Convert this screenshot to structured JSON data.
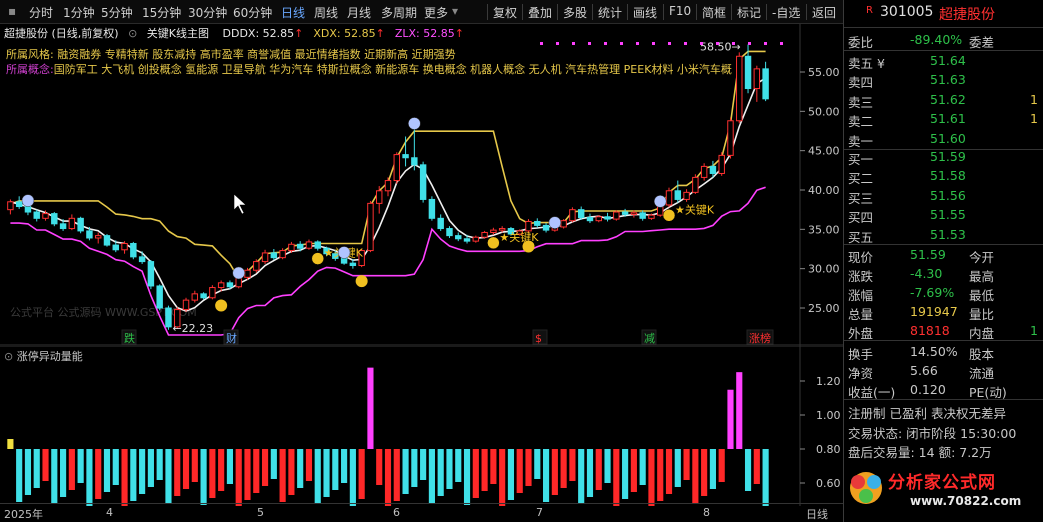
{
  "toolbar": {
    "left_items": [
      {
        "label": "分时",
        "active": false
      },
      {
        "label": "1分钟",
        "active": false
      },
      {
        "label": "5分钟",
        "active": false
      },
      {
        "label": "15分钟",
        "active": false
      },
      {
        "label": "30分钟",
        "active": false
      },
      {
        "label": "60分钟",
        "active": false
      },
      {
        "label": "日线",
        "active": true
      },
      {
        "label": "周线",
        "active": false
      },
      {
        "label": "月线",
        "active": false
      },
      {
        "label": "多周期",
        "active": false
      },
      {
        "label": "更多",
        "active": false
      }
    ],
    "right_items": [
      "复权",
      "叠加",
      "多股",
      "统计",
      "画线",
      "F10",
      "简框",
      "标记",
      "-自选",
      "返回"
    ]
  },
  "main_chart": {
    "title": "超捷股份 (日线,前复权)",
    "indicator": "关键K线主图",
    "values": [
      {
        "label": "DDDX: 52.85",
        "color": "#e8e8e8"
      },
      {
        "label": "XDX: 52.85",
        "color": "#e6c84a"
      },
      {
        "label": "ZLX: 52.85",
        "color": "#ff50ff"
      }
    ],
    "concept_line1": "所属风格:  融资融券  专精特新  股东减持  高市盈率  商誉减值  最近情绪指数  近期新高  近期强势",
    "concept_label": "所属概念:",
    "concept_line2": "国防军工  大飞机  创投概念  氢能源  卫星导航  华为汽车  特斯拉概念  新能源车  换电概念  机器人概念  无人机  汽车热管理  PEEK材料  小米汽车概",
    "high_label": "58.50",
    "low_label": "22.23",
    "key_k_label": "关键K",
    "watermark": "公式平台 公式源码 WWW.GSPT.COM",
    "event_tags": [
      {
        "label": "跌",
        "color": "#2ec04a"
      },
      {
        "label": "财",
        "color": "#6aa8ff"
      },
      {
        "label": "$",
        "color": "#ff3030"
      },
      {
        "label": "减",
        "color": "#2ec04a"
      },
      {
        "label": "涨榜",
        "color": "#ff3030"
      }
    ],
    "y_ticks": [
      "55.00",
      "50.00",
      "45.00",
      "40.00",
      "35.00",
      "30.00",
      "25.00"
    ]
  },
  "sub_chart": {
    "title": "涨停异动量能",
    "y_ticks": [
      "1.20",
      "1.00",
      "0.80",
      "0.60"
    ]
  },
  "x_axis": [
    "2025年",
    "4",
    "5",
    "6",
    "7",
    "8"
  ],
  "x_axis_right": "日线",
  "panel": {
    "code": "301005",
    "name": "超捷股份",
    "ratio": {
      "label": "委比",
      "value": "-89.40%",
      "label2": "委差"
    },
    "asks": [
      {
        "label": "卖五 ¥",
        "price": "51.64",
        "vol": ""
      },
      {
        "label": "卖四",
        "price": "51.63",
        "vol": ""
      },
      {
        "label": "卖三",
        "price": "51.62",
        "vol": "1"
      },
      {
        "label": "卖二",
        "price": "51.61",
        "vol": "1"
      },
      {
        "label": "卖一",
        "price": "51.60",
        "vol": ""
      }
    ],
    "bids": [
      {
        "label": "买一",
        "price": "51.59",
        "vol": ""
      },
      {
        "label": "买二",
        "price": "51.58",
        "vol": ""
      },
      {
        "label": "买三",
        "price": "51.56",
        "vol": ""
      },
      {
        "label": "买四",
        "price": "51.55",
        "vol": ""
      },
      {
        "label": "买五",
        "price": "51.53",
        "vol": ""
      }
    ],
    "quote": [
      {
        "label": "现价",
        "value": "51.59",
        "label2": "今开",
        "value2": ""
      },
      {
        "label": "涨跌",
        "value": "-4.30",
        "label2": "最高",
        "value2": ""
      },
      {
        "label": "涨幅",
        "value": "-7.69%",
        "label2": "最低",
        "value2": ""
      },
      {
        "label": "总量",
        "value": "191947",
        "label2": "量比",
        "value2": ""
      },
      {
        "label": "外盘",
        "value": "81818",
        "label2": "内盘",
        "value2": "1"
      }
    ],
    "stats": [
      {
        "label": "换手",
        "value": "14.50%",
        "label2": "股本"
      },
      {
        "label": "净资",
        "value": "5.66",
        "label2": "流通"
      },
      {
        "label": "收益(一)",
        "value": "0.120",
        "label2": "PE(动)"
      }
    ],
    "flags": "注册制  已盈利  表决权无差异",
    "trade_status": "交易状态: 闭市阶段 15:30:00",
    "after_hours": "盘后交易量: 14  额: 7.2万",
    "logo_text": "分析家公式网",
    "logo_url": "www.70822.com"
  },
  "chart_data": {
    "type": "candlestick",
    "title": "超捷股份 (日线,前复权)",
    "ylim": [
      20,
      59
    ],
    "price_series_approx": [
      [
        37.5,
        38.8,
        36.9,
        38.5
      ],
      [
        38.5,
        39.2,
        37.6,
        37.9
      ],
      [
        37.9,
        38.4,
        36.8,
        37.2
      ],
      [
        37.2,
        37.5,
        36.0,
        36.4
      ],
      [
        36.4,
        37.4,
        36.1,
        37.0
      ],
      [
        37.0,
        37.2,
        35.4,
        35.7
      ],
      [
        35.7,
        36.3,
        34.8,
        35.1
      ],
      [
        35.1,
        36.9,
        34.9,
        36.4
      ],
      [
        36.4,
        36.6,
        34.5,
        34.8
      ],
      [
        34.8,
        35.3,
        33.6,
        33.9
      ],
      [
        33.9,
        34.6,
        33.2,
        34.2
      ],
      [
        34.2,
        34.4,
        32.8,
        33.0
      ],
      [
        33.0,
        33.6,
        32.1,
        32.4
      ],
      [
        32.4,
        33.5,
        31.9,
        33.2
      ],
      [
        33.2,
        33.4,
        31.2,
        31.5
      ],
      [
        31.5,
        32.2,
        30.6,
        30.9
      ],
      [
        30.9,
        31.1,
        27.4,
        27.8
      ],
      [
        27.8,
        28.0,
        24.7,
        25.0
      ],
      [
        25.0,
        25.3,
        22.23,
        22.6
      ],
      [
        22.6,
        25.1,
        22.4,
        24.8
      ],
      [
        24.8,
        26.3,
        24.5,
        26.0
      ],
      [
        26.0,
        27.2,
        25.7,
        26.8
      ],
      [
        26.8,
        27.0,
        26.1,
        26.3
      ],
      [
        26.3,
        27.9,
        26.1,
        27.6
      ],
      [
        27.6,
        28.5,
        27.1,
        28.2
      ],
      [
        28.2,
        28.5,
        27.4,
        27.7
      ],
      [
        27.7,
        29.2,
        27.5,
        28.9
      ],
      [
        28.9,
        30.1,
        28.6,
        29.8
      ],
      [
        29.8,
        31.2,
        29.5,
        30.9
      ],
      [
        30.9,
        32.4,
        30.6,
        32.0
      ],
      [
        32.0,
        32.5,
        31.1,
        31.4
      ],
      [
        31.4,
        32.6,
        31.2,
        32.3
      ],
      [
        32.3,
        33.4,
        32.0,
        33.1
      ],
      [
        33.1,
        33.5,
        32.2,
        32.6
      ],
      [
        32.6,
        33.7,
        32.4,
        33.4
      ],
      [
        33.4,
        33.6,
        32.3,
        32.6
      ],
      [
        32.6,
        32.8,
        31.6,
        31.9
      ],
      [
        31.9,
        32.3,
        31.0,
        31.3
      ],
      [
        31.3,
        31.8,
        30.5,
        30.7
      ],
      [
        30.7,
        31.2,
        30.0,
        30.4
      ],
      [
        30.4,
        32.5,
        30.2,
        32.3
      ],
      [
        32.3,
        38.6,
        32.1,
        38.3
      ],
      [
        38.3,
        40.5,
        37.0,
        39.9
      ],
      [
        39.9,
        41.6,
        39.2,
        41.2
      ],
      [
        41.2,
        44.8,
        40.8,
        44.5
      ],
      [
        44.5,
        46.8,
        43.0,
        44.1
      ],
      [
        44.1,
        48.2,
        42.5,
        43.2
      ],
      [
        43.2,
        43.6,
        38.4,
        38.8
      ],
      [
        38.8,
        39.2,
        36.1,
        36.4
      ],
      [
        36.4,
        36.9,
        34.8,
        35.1
      ],
      [
        35.1,
        35.4,
        33.9,
        34.2
      ],
      [
        34.2,
        34.6,
        33.5,
        33.8
      ],
      [
        33.8,
        34.3,
        33.2,
        33.5
      ],
      [
        33.5,
        34.2,
        33.3,
        34.0
      ],
      [
        34.0,
        34.8,
        33.8,
        34.6
      ],
      [
        34.6,
        35.2,
        34.3,
        34.9
      ],
      [
        34.9,
        35.4,
        34.6,
        35.1
      ],
      [
        35.1,
        35.3,
        34.2,
        34.4
      ],
      [
        34.4,
        35.0,
        34.2,
        34.8
      ],
      [
        34.8,
        36.3,
        34.6,
        36.0
      ],
      [
        36.0,
        36.4,
        35.2,
        35.5
      ],
      [
        35.5,
        35.8,
        34.6,
        34.9
      ],
      [
        34.9,
        35.6,
        34.7,
        35.3
      ],
      [
        35.3,
        36.3,
        35.1,
        36.1
      ],
      [
        36.1,
        37.8,
        35.9,
        37.5
      ],
      [
        37.5,
        37.9,
        36.2,
        36.5
      ],
      [
        36.5,
        37.0,
        35.8,
        36.1
      ],
      [
        36.1,
        36.8,
        35.9,
        36.6
      ],
      [
        36.6,
        37.1,
        36.0,
        36.3
      ],
      [
        36.3,
        37.4,
        36.1,
        37.2
      ],
      [
        37.2,
        37.6,
        36.6,
        36.9
      ],
      [
        36.9,
        37.4,
        36.5,
        37.1
      ],
      [
        37.1,
        37.4,
        36.1,
        36.4
      ],
      [
        36.4,
        37.0,
        36.2,
        36.8
      ],
      [
        36.8,
        38.3,
        36.6,
        38.1
      ],
      [
        38.1,
        40.3,
        37.8,
        39.9
      ],
      [
        39.9,
        41.2,
        38.4,
        38.8
      ],
      [
        38.8,
        40.1,
        38.5,
        39.7
      ],
      [
        39.7,
        42.0,
        39.5,
        41.6
      ],
      [
        41.6,
        43.4,
        41.2,
        43.0
      ],
      [
        43.0,
        43.7,
        41.6,
        42.1
      ],
      [
        42.1,
        44.8,
        41.8,
        44.4
      ],
      [
        44.4,
        49.2,
        44.0,
        48.8
      ],
      [
        48.8,
        57.5,
        48.5,
        57.0
      ],
      [
        57.0,
        58.5,
        52.3,
        52.9
      ],
      [
        52.9,
        55.8,
        51.2,
        55.4
      ],
      [
        55.4,
        56.3,
        51.3,
        51.59
      ]
    ],
    "x_months": [
      "2025年",
      "4",
      "5",
      "6",
      "7",
      "8"
    ],
    "indicators": [
      "DDDX",
      "XDX",
      "ZLX"
    ]
  }
}
